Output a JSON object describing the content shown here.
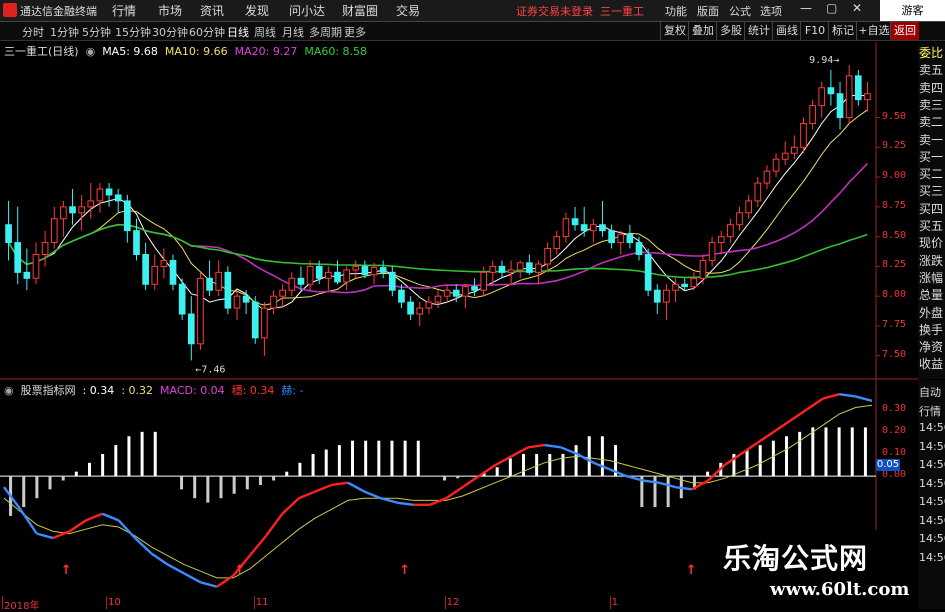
{
  "app": {
    "title": "通达信金融终端",
    "menu": [
      "行情",
      "市场",
      "资讯",
      "发现",
      "问小达",
      "财富圈",
      "交易"
    ],
    "status": "证券交易未登录",
    "stock_name": "三一重工",
    "right_menu": [
      "功能",
      "版面",
      "公式",
      "选项"
    ],
    "guest": "游客"
  },
  "tabs": {
    "periods": [
      "分时",
      "1分钟",
      "5分钟",
      "15分钟",
      "30分钟",
      "60分钟",
      "日线",
      "周线",
      "月线",
      "多周期",
      "更多"
    ],
    "active": "日线",
    "right": [
      "复权",
      "叠加",
      "多股",
      "统计",
      "画线",
      "F10",
      "标记",
      "+自选",
      "返回"
    ]
  },
  "main_legend": {
    "title": "三一重工(日线)",
    "items": [
      {
        "label": "MA5: 9.68",
        "color": "#ffffff"
      },
      {
        "label": "MA10: 9.66",
        "color": "#f0e060"
      },
      {
        "label": "MA20: 9.27",
        "color": "#e040e0"
      },
      {
        "label": "MA60: 8.58",
        "color": "#30d030"
      }
    ]
  },
  "sub_legend": {
    "title": "股票指标网",
    "items": [
      {
        "label": ": 0.34",
        "color": "#ffffff"
      },
      {
        "label": ": 0.32",
        "color": "#f0e060"
      },
      {
        "label": "MACD: 0.04",
        "color": "#e040e0"
      },
      {
        "label": "穩: 0.34",
        "color": "#ff3030"
      },
      {
        "label": "赫: -",
        "color": "#3080ff"
      }
    ]
  },
  "sidebar": [
    "委比",
    "卖五",
    "卖四",
    "卖三",
    "卖二",
    "卖一",
    "买一",
    "买二",
    "买三",
    "买四",
    "买五",
    "现价",
    "涨跌",
    "涨幅",
    "总量",
    "外盘",
    "换手",
    "净资",
    "收益"
  ],
  "sidebar2": [
    "自动",
    "行情",
    "14:56",
    "14:56",
    "14:56",
    "14:56",
    "14:56",
    "14:56",
    "14:56",
    "14:56"
  ],
  "chart_data": [
    {
      "type": "candlestick",
      "title": "三一重工(日线)",
      "yticks": [
        7.5,
        7.75,
        8.0,
        8.25,
        8.5,
        8.75,
        9.0,
        9.25,
        9.5
      ],
      "ylim": [
        7.38,
        10.0
      ],
      "annotations": [
        {
          "text": "7.46",
          "value": 7.46
        },
        {
          "text": "9.94",
          "value": 9.94
        }
      ],
      "ohlc": [
        [
          8.6,
          8.8,
          8.3,
          8.45
        ],
        [
          8.45,
          8.75,
          8.1,
          8.2
        ],
        [
          8.2,
          8.4,
          8.05,
          8.15
        ],
        [
          8.15,
          8.45,
          8.1,
          8.35
        ],
        [
          8.35,
          8.55,
          8.25,
          8.45
        ],
        [
          8.45,
          8.75,
          8.4,
          8.65
        ],
        [
          8.65,
          8.8,
          8.5,
          8.75
        ],
        [
          8.75,
          8.9,
          8.6,
          8.7
        ],
        [
          8.7,
          8.85,
          8.55,
          8.75
        ],
        [
          8.75,
          8.95,
          8.65,
          8.8
        ],
        [
          8.8,
          8.95,
          8.7,
          8.9
        ],
        [
          8.9,
          8.95,
          8.75,
          8.85
        ],
        [
          8.85,
          8.9,
          8.7,
          8.8
        ],
        [
          8.8,
          8.85,
          8.45,
          8.55
        ],
        [
          8.55,
          8.65,
          8.3,
          8.35
        ],
        [
          8.35,
          8.45,
          8.05,
          8.1
        ],
        [
          8.1,
          8.35,
          8.05,
          8.25
        ],
        [
          8.25,
          8.4,
          8.15,
          8.3
        ],
        [
          8.3,
          8.35,
          8.05,
          8.1
        ],
        [
          8.1,
          8.15,
          7.8,
          7.85
        ],
        [
          7.85,
          8.0,
          7.46,
          7.6
        ],
        [
          7.6,
          8.2,
          7.55,
          8.15
        ],
        [
          8.15,
          8.3,
          8.0,
          8.05
        ],
        [
          8.05,
          8.3,
          8.0,
          8.2
        ],
        [
          8.2,
          8.25,
          7.85,
          7.9
        ],
        [
          7.9,
          8.05,
          7.8,
          8.0
        ],
        [
          8.0,
          8.05,
          7.85,
          7.95
        ],
        [
          7.95,
          8.0,
          7.6,
          7.65
        ],
        [
          7.65,
          7.95,
          7.5,
          7.9
        ],
        [
          7.9,
          8.05,
          7.85,
          8.0
        ],
        [
          8.0,
          8.1,
          7.9,
          8.05
        ],
        [
          8.05,
          8.2,
          8.0,
          8.15
        ],
        [
          8.15,
          8.25,
          8.05,
          8.1
        ],
        [
          8.1,
          8.3,
          8.05,
          8.25
        ],
        [
          8.25,
          8.3,
          8.1,
          8.15
        ],
        [
          8.15,
          8.25,
          8.05,
          8.2
        ],
        [
          8.2,
          8.3,
          8.1,
          8.12
        ],
        [
          8.12,
          8.25,
          8.05,
          8.22
        ],
        [
          8.22,
          8.3,
          8.15,
          8.25
        ],
        [
          8.25,
          8.3,
          8.15,
          8.18
        ],
        [
          8.18,
          8.28,
          8.1,
          8.24
        ],
        [
          8.24,
          8.3,
          8.15,
          8.2
        ],
        [
          8.2,
          8.25,
          8.0,
          8.05
        ],
        [
          8.05,
          8.1,
          7.9,
          7.95
        ],
        [
          7.95,
          8.0,
          7.8,
          7.85
        ],
        [
          7.85,
          7.95,
          7.75,
          7.9
        ],
        [
          7.9,
          8.0,
          7.85,
          7.95
        ],
        [
          7.95,
          8.05,
          7.9,
          8.0
        ],
        [
          8.0,
          8.1,
          7.95,
          8.05
        ],
        [
          8.05,
          8.1,
          7.95,
          8.0
        ],
        [
          8.0,
          8.1,
          7.9,
          8.08
        ],
        [
          8.08,
          8.15,
          8.0,
          8.05
        ],
        [
          8.05,
          8.25,
          8.0,
          8.2
        ],
        [
          8.2,
          8.3,
          8.1,
          8.25
        ],
        [
          8.25,
          8.3,
          8.15,
          8.2
        ],
        [
          8.2,
          8.3,
          8.1,
          8.22
        ],
        [
          8.22,
          8.3,
          8.15,
          8.28
        ],
        [
          8.28,
          8.35,
          8.18,
          8.2
        ],
        [
          8.2,
          8.3,
          8.1,
          8.27
        ],
        [
          8.27,
          8.45,
          8.2,
          8.4
        ],
        [
          8.4,
          8.55,
          8.35,
          8.5
        ],
        [
          8.5,
          8.7,
          8.45,
          8.65
        ],
        [
          8.65,
          8.75,
          8.55,
          8.6
        ],
        [
          8.6,
          8.75,
          8.5,
          8.55
        ],
        [
          8.55,
          8.65,
          8.45,
          8.6
        ],
        [
          8.6,
          8.8,
          8.5,
          8.55
        ],
        [
          8.55,
          8.6,
          8.4,
          8.45
        ],
        [
          8.45,
          8.55,
          8.35,
          8.52
        ],
        [
          8.52,
          8.6,
          8.4,
          8.45
        ],
        [
          8.45,
          8.5,
          8.3,
          8.35
        ],
        [
          8.35,
          8.4,
          8.0,
          8.05
        ],
        [
          8.05,
          8.1,
          7.85,
          7.95
        ],
        [
          7.95,
          8.1,
          7.8,
          8.05
        ],
        [
          8.05,
          8.15,
          7.95,
          8.1
        ],
        [
          8.1,
          8.15,
          8.05,
          8.08
        ],
        [
          8.08,
          8.2,
          8.05,
          8.15
        ],
        [
          8.15,
          8.35,
          8.1,
          8.3
        ],
        [
          8.3,
          8.5,
          8.25,
          8.45
        ],
        [
          8.45,
          8.55,
          8.35,
          8.5
        ],
        [
          8.5,
          8.65,
          8.45,
          8.6
        ],
        [
          8.6,
          8.75,
          8.55,
          8.7
        ],
        [
          8.7,
          8.85,
          8.65,
          8.8
        ],
        [
          8.8,
          9.0,
          8.75,
          8.95
        ],
        [
          8.95,
          9.1,
          8.9,
          9.05
        ],
        [
          9.05,
          9.2,
          9.0,
          9.15
        ],
        [
          9.15,
          9.3,
          9.1,
          9.2
        ],
        [
          9.2,
          9.35,
          9.15,
          9.25
        ],
        [
          9.25,
          9.5,
          9.2,
          9.45
        ],
        [
          9.45,
          9.65,
          9.4,
          9.6
        ],
        [
          9.6,
          9.8,
          9.5,
          9.75
        ],
        [
          9.75,
          9.9,
          9.6,
          9.7
        ],
        [
          9.7,
          9.8,
          9.4,
          9.5
        ],
        [
          9.5,
          9.94,
          9.45,
          9.85
        ],
        [
          9.85,
          9.9,
          9.6,
          9.65
        ],
        [
          9.65,
          9.8,
          9.55,
          9.7
        ]
      ]
    },
    {
      "type": "macd",
      "title": "股票指标网",
      "yticks": [
        0.0,
        0.1,
        0.2,
        0.3
      ],
      "ylim": [
        -0.56,
        0.38
      ],
      "current_marker": "0.05",
      "macd_bars": [
        -0.18,
        -0.14,
        -0.1,
        -0.06,
        -0.02,
        0.02,
        0.06,
        0.1,
        0.14,
        0.18,
        0.2,
        0.2,
        0.0,
        -0.06,
        -0.1,
        -0.12,
        -0.1,
        -0.08,
        -0.06,
        -0.04,
        -0.02,
        0.02,
        0.06,
        0.1,
        0.12,
        0.14,
        0.16,
        0.16,
        0.16,
        0.16,
        0.16,
        0.16,
        0.0,
        -0.02,
        -0.01,
        0.0,
        0.02,
        0.04,
        0.08,
        0.1,
        0.1,
        0.1,
        0.1,
        0.14,
        0.18,
        0.18,
        0.14,
        0.0,
        -0.14,
        -0.14,
        -0.14,
        -0.1,
        -0.06,
        0.02,
        0.06,
        0.1,
        0.12,
        0.14,
        0.16,
        0.18,
        0.2,
        0.22,
        0.22,
        0.22,
        0.22,
        0.22
      ],
      "dif": [
        -0.05,
        -0.15,
        -0.26,
        -0.28,
        -0.25,
        -0.2,
        -0.17,
        -0.2,
        -0.28,
        -0.35,
        -0.4,
        -0.44,
        -0.48,
        -0.5,
        -0.45,
        -0.36,
        -0.27,
        -0.17,
        -0.1,
        -0.07,
        -0.04,
        -0.03,
        -0.07,
        -0.1,
        -0.12,
        -0.13,
        -0.13,
        -0.1,
        -0.05,
        0.0,
        0.05,
        0.09,
        0.13,
        0.14,
        0.13,
        0.1,
        0.06,
        0.03,
        0.0,
        -0.02,
        -0.03,
        -0.05,
        -0.06,
        -0.02,
        0.05,
        0.1,
        0.15,
        0.2,
        0.25,
        0.3,
        0.35,
        0.37,
        0.36,
        0.34
      ],
      "dea": [
        -0.1,
        -0.16,
        -0.22,
        -0.25,
        -0.26,
        -0.24,
        -0.22,
        -0.23,
        -0.27,
        -0.32,
        -0.36,
        -0.4,
        -0.43,
        -0.46,
        -0.46,
        -0.42,
        -0.36,
        -0.3,
        -0.24,
        -0.19,
        -0.15,
        -0.11,
        -0.1,
        -0.1,
        -0.1,
        -0.11,
        -0.11,
        -0.11,
        -0.09,
        -0.06,
        -0.03,
        0.0,
        0.03,
        0.06,
        0.08,
        0.09,
        0.08,
        0.07,
        0.05,
        0.03,
        0.01,
        -0.01,
        -0.03,
        -0.03,
        -0.01,
        0.02,
        0.05,
        0.09,
        0.13,
        0.18,
        0.23,
        0.28,
        0.31,
        0.32
      ],
      "signal_arrows": [
        0.07,
        0.27,
        0.46,
        0.79
      ]
    }
  ],
  "x_axis": [
    {
      "label": "2018年",
      "pos": 0.0
    },
    {
      "label": "10",
      "pos": 0.12
    },
    {
      "label": "11",
      "pos": 0.29
    },
    {
      "label": "12",
      "pos": 0.51
    },
    {
      "label": "1",
      "pos": 0.7
    }
  ],
  "watermark": {
    "cn": "乐淘公式网",
    "url": "www.60lt.com"
  }
}
